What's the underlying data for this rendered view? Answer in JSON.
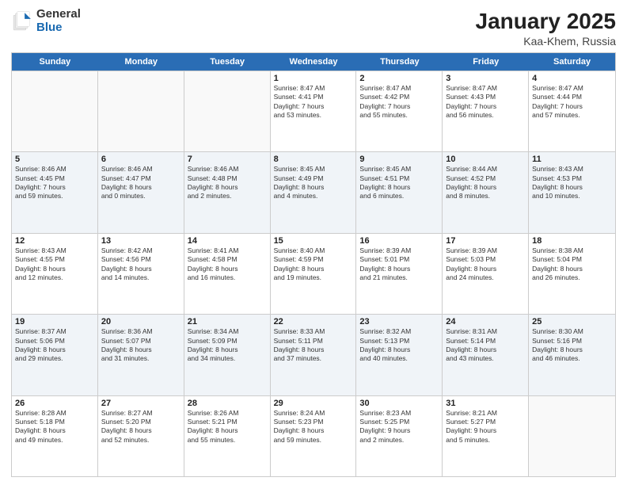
{
  "logo": {
    "general": "General",
    "blue": "Blue"
  },
  "header": {
    "month": "January 2025",
    "location": "Kaa-Khem, Russia"
  },
  "weekdays": [
    "Sunday",
    "Monday",
    "Tuesday",
    "Wednesday",
    "Thursday",
    "Friday",
    "Saturday"
  ],
  "weeks": [
    [
      {
        "day": "",
        "info": ""
      },
      {
        "day": "",
        "info": ""
      },
      {
        "day": "",
        "info": ""
      },
      {
        "day": "1",
        "info": "Sunrise: 8:47 AM\nSunset: 4:41 PM\nDaylight: 7 hours\nand 53 minutes."
      },
      {
        "day": "2",
        "info": "Sunrise: 8:47 AM\nSunset: 4:42 PM\nDaylight: 7 hours\nand 55 minutes."
      },
      {
        "day": "3",
        "info": "Sunrise: 8:47 AM\nSunset: 4:43 PM\nDaylight: 7 hours\nand 56 minutes."
      },
      {
        "day": "4",
        "info": "Sunrise: 8:47 AM\nSunset: 4:44 PM\nDaylight: 7 hours\nand 57 minutes."
      }
    ],
    [
      {
        "day": "5",
        "info": "Sunrise: 8:46 AM\nSunset: 4:45 PM\nDaylight: 7 hours\nand 59 minutes."
      },
      {
        "day": "6",
        "info": "Sunrise: 8:46 AM\nSunset: 4:47 PM\nDaylight: 8 hours\nand 0 minutes."
      },
      {
        "day": "7",
        "info": "Sunrise: 8:46 AM\nSunset: 4:48 PM\nDaylight: 8 hours\nand 2 minutes."
      },
      {
        "day": "8",
        "info": "Sunrise: 8:45 AM\nSunset: 4:49 PM\nDaylight: 8 hours\nand 4 minutes."
      },
      {
        "day": "9",
        "info": "Sunrise: 8:45 AM\nSunset: 4:51 PM\nDaylight: 8 hours\nand 6 minutes."
      },
      {
        "day": "10",
        "info": "Sunrise: 8:44 AM\nSunset: 4:52 PM\nDaylight: 8 hours\nand 8 minutes."
      },
      {
        "day": "11",
        "info": "Sunrise: 8:43 AM\nSunset: 4:53 PM\nDaylight: 8 hours\nand 10 minutes."
      }
    ],
    [
      {
        "day": "12",
        "info": "Sunrise: 8:43 AM\nSunset: 4:55 PM\nDaylight: 8 hours\nand 12 minutes."
      },
      {
        "day": "13",
        "info": "Sunrise: 8:42 AM\nSunset: 4:56 PM\nDaylight: 8 hours\nand 14 minutes."
      },
      {
        "day": "14",
        "info": "Sunrise: 8:41 AM\nSunset: 4:58 PM\nDaylight: 8 hours\nand 16 minutes."
      },
      {
        "day": "15",
        "info": "Sunrise: 8:40 AM\nSunset: 4:59 PM\nDaylight: 8 hours\nand 19 minutes."
      },
      {
        "day": "16",
        "info": "Sunrise: 8:39 AM\nSunset: 5:01 PM\nDaylight: 8 hours\nand 21 minutes."
      },
      {
        "day": "17",
        "info": "Sunrise: 8:39 AM\nSunset: 5:03 PM\nDaylight: 8 hours\nand 24 minutes."
      },
      {
        "day": "18",
        "info": "Sunrise: 8:38 AM\nSunset: 5:04 PM\nDaylight: 8 hours\nand 26 minutes."
      }
    ],
    [
      {
        "day": "19",
        "info": "Sunrise: 8:37 AM\nSunset: 5:06 PM\nDaylight: 8 hours\nand 29 minutes."
      },
      {
        "day": "20",
        "info": "Sunrise: 8:36 AM\nSunset: 5:07 PM\nDaylight: 8 hours\nand 31 minutes."
      },
      {
        "day": "21",
        "info": "Sunrise: 8:34 AM\nSunset: 5:09 PM\nDaylight: 8 hours\nand 34 minutes."
      },
      {
        "day": "22",
        "info": "Sunrise: 8:33 AM\nSunset: 5:11 PM\nDaylight: 8 hours\nand 37 minutes."
      },
      {
        "day": "23",
        "info": "Sunrise: 8:32 AM\nSunset: 5:13 PM\nDaylight: 8 hours\nand 40 minutes."
      },
      {
        "day": "24",
        "info": "Sunrise: 8:31 AM\nSunset: 5:14 PM\nDaylight: 8 hours\nand 43 minutes."
      },
      {
        "day": "25",
        "info": "Sunrise: 8:30 AM\nSunset: 5:16 PM\nDaylight: 8 hours\nand 46 minutes."
      }
    ],
    [
      {
        "day": "26",
        "info": "Sunrise: 8:28 AM\nSunset: 5:18 PM\nDaylight: 8 hours\nand 49 minutes."
      },
      {
        "day": "27",
        "info": "Sunrise: 8:27 AM\nSunset: 5:20 PM\nDaylight: 8 hours\nand 52 minutes."
      },
      {
        "day": "28",
        "info": "Sunrise: 8:26 AM\nSunset: 5:21 PM\nDaylight: 8 hours\nand 55 minutes."
      },
      {
        "day": "29",
        "info": "Sunrise: 8:24 AM\nSunset: 5:23 PM\nDaylight: 8 hours\nand 59 minutes."
      },
      {
        "day": "30",
        "info": "Sunrise: 8:23 AM\nSunset: 5:25 PM\nDaylight: 9 hours\nand 2 minutes."
      },
      {
        "day": "31",
        "info": "Sunrise: 8:21 AM\nSunset: 5:27 PM\nDaylight: 9 hours\nand 5 minutes."
      },
      {
        "day": "",
        "info": ""
      }
    ]
  ]
}
